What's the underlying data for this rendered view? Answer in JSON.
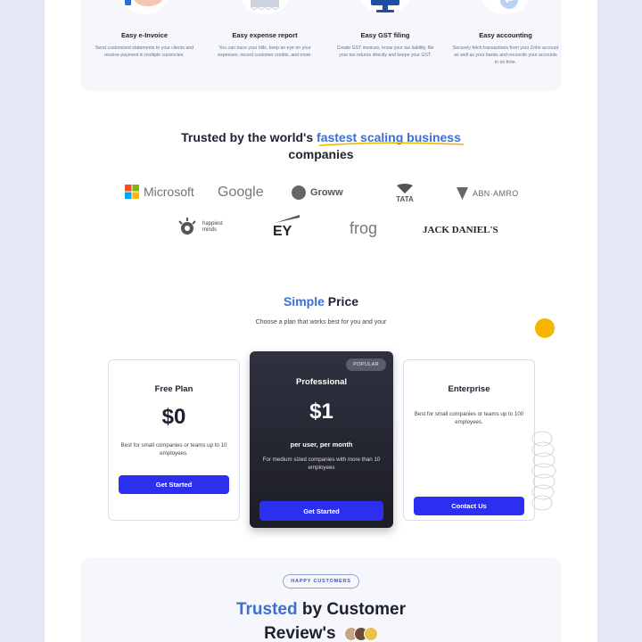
{
  "features": [
    {
      "title": "Easy e-Invoice",
      "text": "Send customized statements to your clients and receive payment in multiple currencies.",
      "icon": "invoice-icon"
    },
    {
      "title": "Easy expense report",
      "text": "You can trace your bills, keep an eye on your expenses, record customer credits, and more.",
      "icon": "receipt-icon"
    },
    {
      "title": "Easy GST filing",
      "text": "Create GST invoices, know your tax liability, file your tax returns directly and keeps your GST.",
      "icon": "monitor-icon"
    },
    {
      "title": "Easy accounting",
      "text": "Securely fetch transactions from your Zoho account as well as your banks and reconcile your accounts in no time.",
      "icon": "accounting-icon"
    }
  ],
  "trusted": {
    "prefix": "Trusted by the world's ",
    "highlight": "fastest scaling business",
    "suffix": "companies"
  },
  "logos": [
    "Microsoft",
    "Google",
    "Groww",
    "TATA",
    "ABN·AMRO",
    "happiest minds",
    "EY",
    "frog",
    "JACK DANIEL'S"
  ],
  "pricing": {
    "title_highlight": "Simple",
    "title_rest": " Price",
    "subtitle": "Choose a plan that works best for you and your",
    "plans": [
      {
        "name": "Free Plan",
        "price": "$0",
        "desc": "Best for small companies or teams up to 10 employees.",
        "button": "Get Started"
      },
      {
        "name": "Professional",
        "price": "$1",
        "per": "per user, per month",
        "desc": "For medium sized companies with more than 10 employees",
        "button": "Get Started",
        "badge": "POPULAR"
      },
      {
        "name": "Enterprise",
        "desc": "Best for small companies or teams up to 100 employees.",
        "button": "Contact Us"
      }
    ]
  },
  "reviews": {
    "pill": "HAPPY CUSTOMERS",
    "title_highlight": "Trusted",
    "title_rest": " by Customer",
    "title_line2": "Review's"
  },
  "colors": {
    "accent": "#3a6fd4",
    "button": "#2c2ff0",
    "yellow": "#f7b500",
    "dark_card": "#23242f"
  }
}
